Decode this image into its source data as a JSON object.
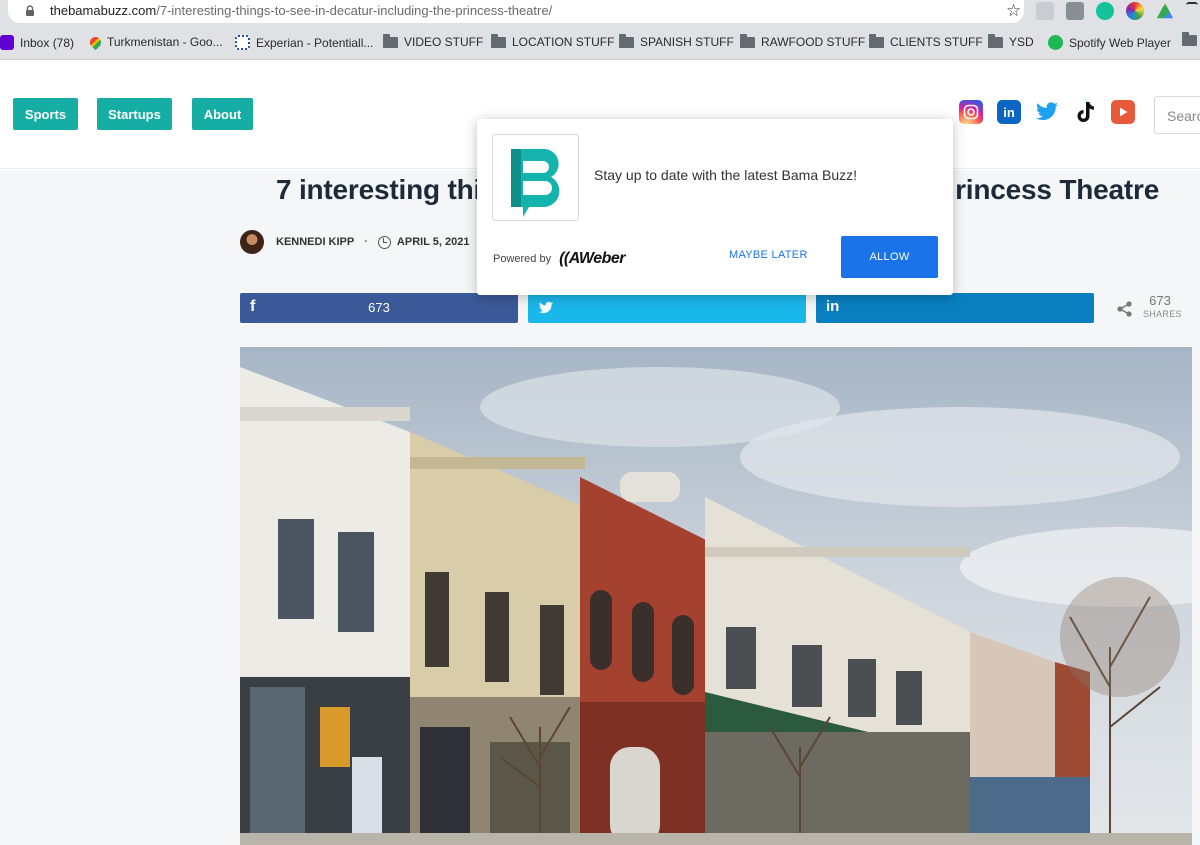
{
  "browser": {
    "url_host": "thebamabuzz.com",
    "url_path": "/7-interesting-things-to-see-in-decatur-including-the-princess-theatre/",
    "bookmarks": [
      {
        "label": "Inbox (78)",
        "icon": "yahoo-mail-icon"
      },
      {
        "label": "Turkmenistan - Goo...",
        "icon": "google-maps-icon"
      },
      {
        "label": "Experian - Potentiall...",
        "icon": "experian-icon"
      },
      {
        "label": "VIDEO STUFF",
        "icon": "folder-icon"
      },
      {
        "label": "LOCATION STUFF",
        "icon": "folder-icon"
      },
      {
        "label": "SPANISH STUFF",
        "icon": "folder-icon"
      },
      {
        "label": "RAWFOOD STUFF",
        "icon": "folder-icon"
      },
      {
        "label": "CLIENTS STUFF",
        "icon": "folder-icon"
      },
      {
        "label": "YSD",
        "icon": "folder-icon"
      },
      {
        "label": "Spotify Web Player",
        "icon": "spotify-icon"
      }
    ]
  },
  "site": {
    "nav": [
      "Sports",
      "Startups",
      "About"
    ],
    "search_placeholder": "Search",
    "accent": "#16ada5"
  },
  "article": {
    "title_left": "7 interesting thi",
    "title_right": "rincess Theatre",
    "author": "KENNEDI KIPP",
    "date": "APRIL 5, 2021",
    "facebook_count": "673",
    "total_shares": "673",
    "shares_label": "SHARES"
  },
  "popup": {
    "message": "Stay up to date with the latest Bama Buzz!",
    "powered_by": "Powered by",
    "brand": "AWeber",
    "maybe_later": "MAYBE LATER",
    "allow": "ALLOW"
  },
  "colors": {
    "facebook": "#3b5998",
    "twitter": "#1ab7ea",
    "linkedin": "#0a7fc0",
    "button_blue": "#1a73e8"
  }
}
